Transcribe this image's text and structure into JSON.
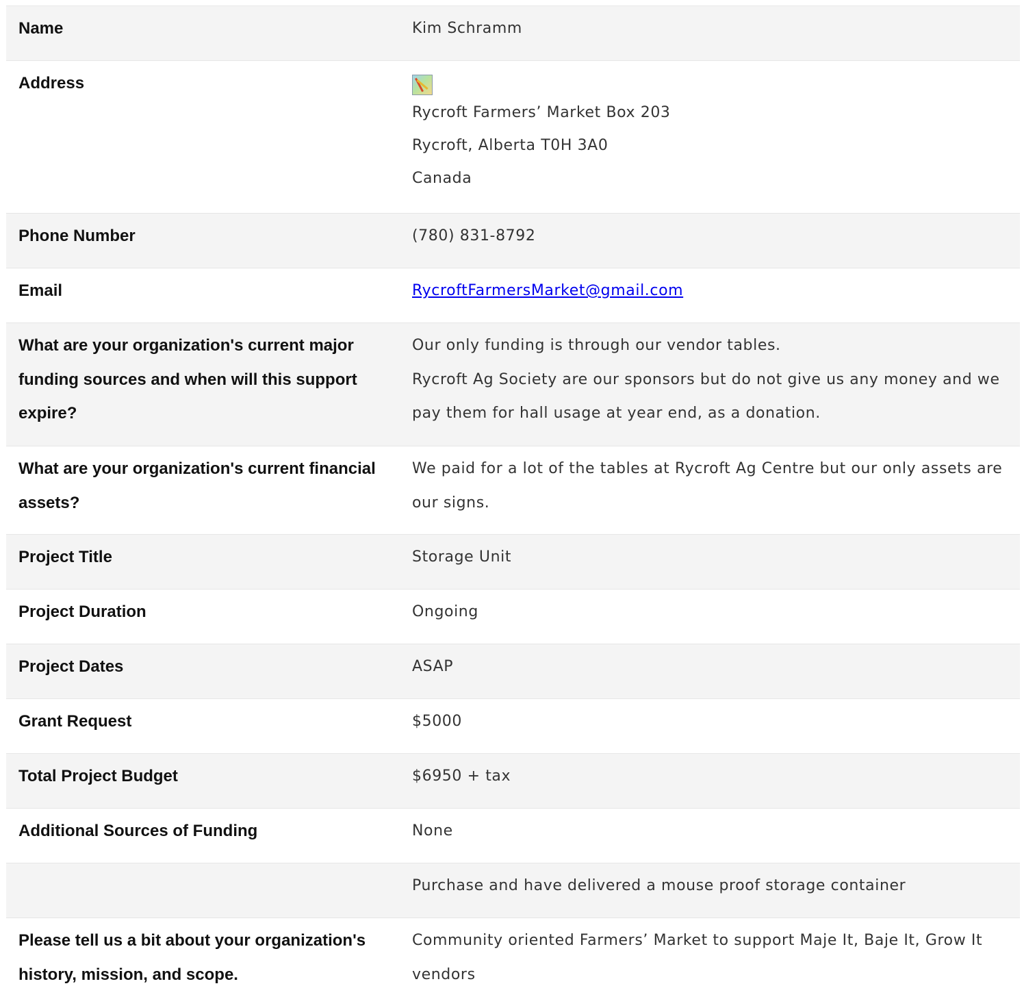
{
  "rows": [
    {
      "label": "Name",
      "value": "Kim Schramm"
    },
    {
      "label": "Address",
      "lines": [
        "Rycroft Farmers’ Market Box 203",
        "Rycroft, Alberta T0H 3A0",
        "Canada"
      ],
      "icon": "map-icon"
    },
    {
      "label": "Phone Number",
      "value": "(780) 831-8792"
    },
    {
      "label": "Email",
      "value": "RycroftFarmersMarket@gmail.com"
    },
    {
      "label": "What are your organization's current major funding sources and when will this support expire?",
      "lines": [
        "Our only funding is through our vendor tables.",
        "Rycroft Ag Society are our sponsors but do not give us any money and we pay them for hall usage at year end, as a donation."
      ]
    },
    {
      "label": "What are your organization's current financial assets?",
      "value": "We paid for a lot of the tables at Rycroft Ag Centre but our only assets are our signs."
    },
    {
      "label": "Project Title",
      "value": "Storage Unit"
    },
    {
      "label": "Project Duration",
      "value": "Ongoing"
    },
    {
      "label": "Project Dates",
      "value": "ASAP"
    },
    {
      "label": "Grant Request",
      "value": "$5000"
    },
    {
      "label": "Total Project Budget",
      "value": "$6950 + tax"
    },
    {
      "label": "Additional Sources of Funding",
      "value": "None"
    },
    {
      "label": "",
      "value": "Purchase and have delivered a mouse proof storage container"
    },
    {
      "label": "Please tell us a bit about your organization's history, mission, and scope.",
      "value": "Community oriented Farmers’ Market to support Maje It, Baje It, Grow It vendors"
    }
  ]
}
